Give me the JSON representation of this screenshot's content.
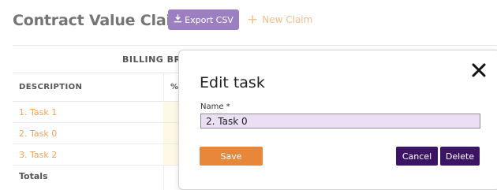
{
  "header": {
    "title": "Contract Value Claims",
    "export_label": "Export CSV",
    "new_claim_label": "New Claim"
  },
  "table": {
    "group_header": "BILLING BREA",
    "columns": {
      "description": "DESCRIPTION",
      "percent": "%"
    },
    "rows": [
      {
        "description": "1. Task 1"
      },
      {
        "description": "2. Task 0"
      },
      {
        "description": "3. Task 2"
      }
    ],
    "totals_label": "Totals"
  },
  "modal": {
    "title": "Edit task",
    "name_label": "Name *",
    "name_value": "2. Task 0",
    "save_label": "Save",
    "cancel_label": "Cancel",
    "delete_label": "Delete"
  },
  "colors": {
    "primary": "#3c1466",
    "accent": "#e8863a",
    "export_button": "#9c7fc0",
    "link": "#f0a45c",
    "input_bg": "#ebdff5"
  },
  "icons": [
    "download-icon",
    "plus-icon",
    "close-icon"
  ]
}
